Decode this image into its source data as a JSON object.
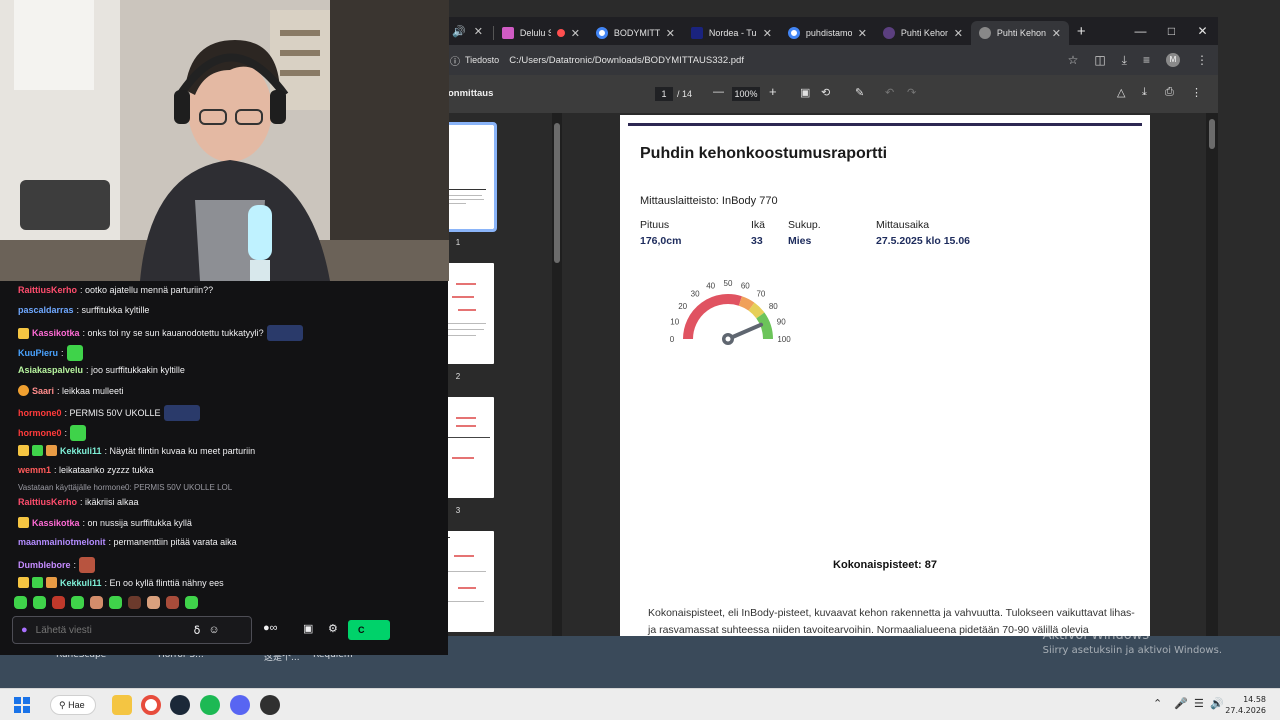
{
  "desktop": {
    "labels": [
      "RuneScape",
      "Horror S...",
      "这是个...",
      "Requiem"
    ],
    "activate_title": "Aktivoi Windows",
    "activate_sub": "Siirry asetuksiin ja aktivoi Windows."
  },
  "browser": {
    "tabs": [
      {
        "title": "Delulu Str",
        "color": "#d05bc4",
        "active": false
      },
      {
        "title": "BODYMITTAU",
        "color": "#4285f4",
        "active": false
      },
      {
        "title": "Nordea - Tun",
        "color": "#1a237e",
        "active": false
      },
      {
        "title": "puhdistamo -",
        "color": "#4285f4",
        "active": false
      },
      {
        "title": "Puhti Kehonk",
        "color": "#5b3f7f",
        "active": false
      },
      {
        "title": "Puhti Kehonk",
        "color": "#888888",
        "active": true
      }
    ],
    "address": {
      "info_label": "Tiedosto",
      "url": "C:/Users/Datatronic/Downloads/BODYMITTAUS332.pdf"
    },
    "pdf_toolbar": {
      "doc_title": "onmittaus",
      "page_current": "1",
      "page_total": "/ 14",
      "zoom": "100%"
    },
    "thumbnails": [
      "1",
      "2",
      "3"
    ]
  },
  "report": {
    "title": "Puhdin kehonkoostumusraportti",
    "device": "Mittauslaitteisto: InBody 770",
    "fields": [
      {
        "label": "Pituus",
        "value": "176,0cm"
      },
      {
        "label": "Ikä",
        "value": "33"
      },
      {
        "label": "Sukup.",
        "value": "Mies"
      },
      {
        "label": "Mittausaika",
        "value": "27.5.2025 klo 15.06"
      }
    ],
    "gauge": {
      "ticks": [
        "0",
        "10",
        "20",
        "30",
        "40",
        "50",
        "60",
        "70",
        "80",
        "90",
        "100"
      ],
      "value": 87
    },
    "total_label": "Kokonaispisteet: 87",
    "description": "Kokonaispisteet, eli InBody-pisteet, kuvaavat kehon rakennetta ja vahvuutta. Tulokseen vaikuttavat lihas- ja rasvamassat suhteessa niiden tavoitearvoihin. Normaalialueena pidetään 70-90 välillä olevia"
  },
  "chat": {
    "messages": [
      {
        "user": "RaittiusKerho",
        "color": "#ff4d6d",
        "text": ": ootko ajatellu mennä parturiin??",
        "badges": []
      },
      {
        "user": "pascaldarras",
        "color": "#6fa8ff",
        "text": ": surffitukka kyltille",
        "badges": []
      },
      {
        "user": "Kassikotka",
        "color": "#ff6bd5",
        "text": ": onks toi ny se sun kauanodotettu tukkatyyli?",
        "badges": [
          "gold"
        ],
        "emote_after": true
      },
      {
        "user": "KuuPieru",
        "color": "#4aa3ff",
        "text": ":",
        "badges": [],
        "emote_after": true
      },
      {
        "user": "Asiakaspalvelu",
        "color": "#b8f5a0",
        "text": ": joo surffitukkakin kyltille",
        "badges": []
      },
      {
        "user": "Saari",
        "color": "#ff8c8c",
        "text": ": leikkaa mulleeti",
        "badges": [
          "one"
        ]
      },
      {
        "user": "hormone0",
        "color": "#ff3b3b",
        "text": ": PERMIS 50V UKOLLE",
        "badges": [],
        "emote_after": true
      },
      {
        "user": "hormone0",
        "color": "#ff3b3b",
        "text": ":",
        "badges": [],
        "emote_after": true
      },
      {
        "user": "Kekkuli11",
        "color": "#7ff0d8",
        "text": ": Näytät flintin kuvaa ku meet parturiin",
        "badges": [
          "crown",
          "green",
          "gift"
        ]
      },
      {
        "user": "wemm1",
        "color": "#ff5a5a",
        "text": ": leikataanko zyzzz tukka",
        "badges": []
      },
      {
        "reply": "Vastataan käyttäjälle hormone0: PERMIS 50V UKOLLE LOL"
      },
      {
        "user": "RaittiusKerho",
        "color": "#ff4d6d",
        "text": ": ikäkriisi alkaa",
        "badges": []
      },
      {
        "user": "Kassikotka",
        "color": "#ff6bd5",
        "text": ": on nussija surffitukka kyllä",
        "badges": [
          "gold"
        ]
      },
      {
        "user": "maanmainiotmelonit",
        "color": "#b38cff",
        "text": ": permanenttiin pitää varata aika",
        "badges": []
      },
      {
        "user": "Dumblebore",
        "color": "#c58cff",
        "text": ":",
        "badges": [],
        "emote_after": true
      },
      {
        "user": "Kekkuli11",
        "color": "#7ff0d8",
        "text": ": En oo kyllä flinttiä nähny ees",
        "badges": [
          "crown",
          "green",
          "gift"
        ]
      }
    ],
    "input_placeholder": "Lähetä viesti",
    "send_label": "C"
  },
  "taskbar": {
    "search_label": "Hae",
    "time": "14.58",
    "date": "27.4.2026"
  }
}
